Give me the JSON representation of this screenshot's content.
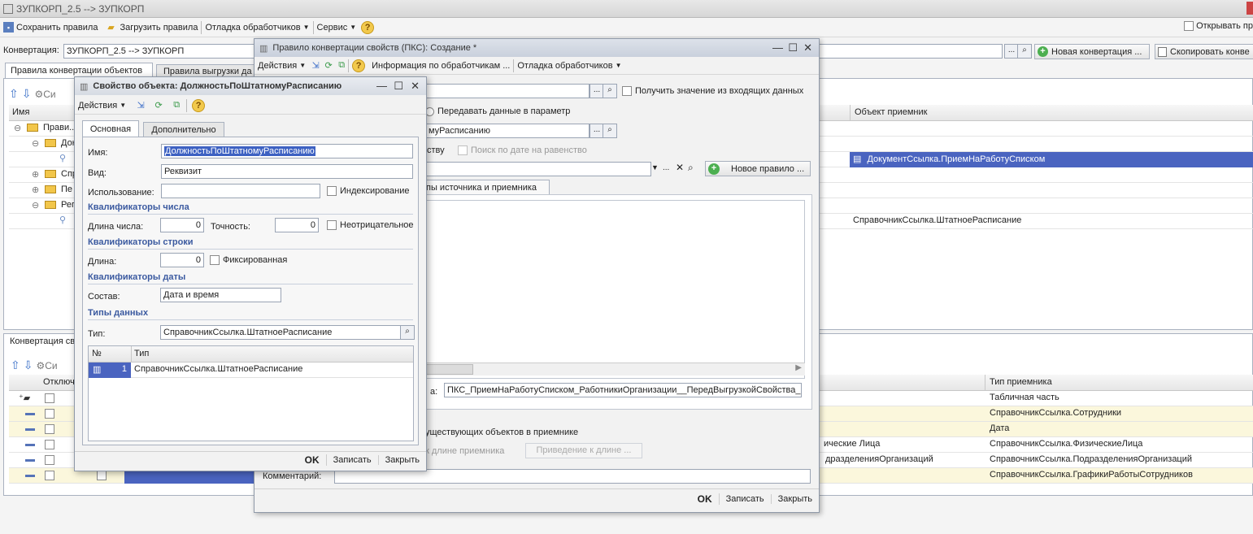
{
  "app_title": "ЗУПКОРП_2.5 --> ЗУПКОРП",
  "main_toolbar": {
    "save_rules": "Сохранить правила",
    "load_rules": "Загрузить правила",
    "debug_handlers": "Отладка обработчиков",
    "service": "Сервис",
    "open_rules": "Открывать пр"
  },
  "conversion": {
    "label": "Конвертация:",
    "value": "ЗУПКОРП_2.5 --> ЗУПКОРП",
    "new_conversion": "Новая конвертация ...",
    "copy_conversion": "Скопировать конве"
  },
  "main_tabs": [
    "Правила конвертации объектов",
    "Правила выгрузки да"
  ],
  "top_table": {
    "col_name": "Имя",
    "col_dest": "Объект приемник",
    "tree_rows": [
      "Прави...",
      "Док",
      "",
      "Спр",
      "Пе",
      "Рег",
      ""
    ],
    "dest_values": [
      "",
      "",
      "ДокументСсылка.ПриемНаРаботуСписком",
      "",
      "",
      "",
      "СправочникСсылка.ШтатноеРасписание"
    ]
  },
  "bottom_panel": {
    "tab": "Конвертация св",
    "col_off": "Отключ",
    "col_dest_type": "Тип приемника",
    "rows": [
      {
        "mid": "",
        "type": "Табличная часть"
      },
      {
        "mid": "",
        "type": "СправочникСсылка.Сотрудники"
      },
      {
        "mid": "",
        "type": "Дата"
      },
      {
        "mid": "ические Лица",
        "type": "СправочникСсылка.ФизическиеЛица"
      },
      {
        "mid": "дразделенияОрганизаций",
        "type": "СправочникСсылка.ПодразделенияОрганизаций"
      },
      {
        "mid": "",
        "type": "СправочникСсылка.ГрафикиРаботыСотрудников"
      }
    ]
  },
  "pks_window": {
    "title": "Правило конвертации свойств (ПКС): Создание *",
    "actions": "Действия",
    "handler_info": "Информация по обработчикам ...",
    "debug_handlers": "Отладка обработчиков",
    "get_from_incoming": "Получить значение из входящих данных",
    "pass_in_param": "Передавать данные в параметр",
    "dest_value": "муРасписанию",
    "search_by_date": "ству",
    "search_by_date_equal": "Поиск по дате на равенство",
    "new_rule": "Новое правило ...",
    "types_tab": "пы источника и приемника",
    "handler_label": "а:",
    "handler_value": "ПКС_ПриемНаРаботуСписком_РаботникиОрганизации__ПередВыгрузкойСвойства_",
    "existing_objects": "уществующих объектов в приемнике",
    "to_dest_length": "к длине приемника",
    "cast_to_length": "Приведение к длине ...",
    "comment_label": "Комментарий:",
    "ok": "OK",
    "write": "Записать",
    "close": "Закрыть"
  },
  "prop_window": {
    "title": "Свойство объекта: ДолжностьПоШтатномуРасписанию",
    "actions": "Действия",
    "tab_main": "Основная",
    "tab_extra": "Дополнительно",
    "name_label": "Имя:",
    "name_value": "ДолжностьПоШтатномуРасписанию",
    "kind_label": "Вид:",
    "kind_value": "Реквизит",
    "usage_label": "Использование:",
    "usage_value": "",
    "indexing": "Индексирование",
    "num_group": "Квалификаторы числа",
    "num_length_label": "Длина числа:",
    "num_length_value": "0",
    "precision_label": "Точность:",
    "precision_value": "0",
    "nonnegative": "Неотрицательное",
    "str_group": "Квалификаторы строки",
    "str_length_label": "Длина:",
    "str_length_value": "0",
    "fixed": "Фиксированная",
    "date_group": "Квалификаторы даты",
    "composition_label": "Состав:",
    "composition_value": "Дата и время",
    "types_group": "Типы данных",
    "type_label": "Тип:",
    "type_value": "СправочникСсылка.ШтатноеРасписание",
    "types_table": {
      "col_num": "№",
      "col_type": "Тип",
      "rows": [
        {
          "num": "1",
          "type": "СправочникСсылка.ШтатноеРасписание"
        }
      ]
    },
    "ok": "OK",
    "write": "Записать",
    "close": "Закрыть"
  },
  "colors": {
    "selection": "#4a64c0",
    "group_header": "#3b5aa0",
    "row_highlight": "#fbf7dc"
  }
}
